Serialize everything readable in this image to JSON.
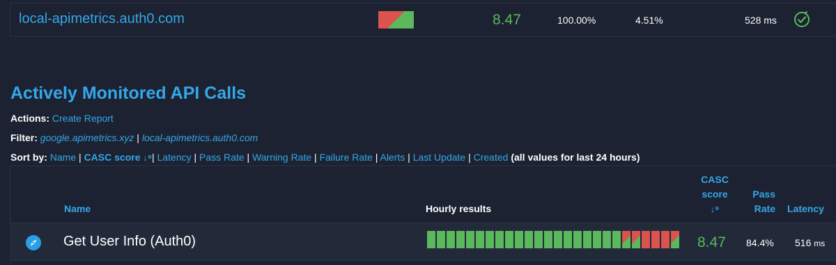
{
  "top_row": {
    "domain": "local-apimetrics.auth0.com",
    "casc_score": "8.47",
    "pass_rate": "100.00%",
    "warning_rate": "4.51%",
    "latency": "528 ms",
    "status_icon": "check-circle-icon"
  },
  "section": {
    "title": "Actively Monitored API Calls",
    "actions_label": "Actions:",
    "actions": [
      "Create Report"
    ],
    "filter_label": "Filter:",
    "filters": [
      "google.apimetrics.xyz",
      "local-apimetrics.auth0.com"
    ],
    "sort_label": "Sort by:",
    "sort_options": [
      "Name",
      "CASC score",
      "Latency",
      "Pass Rate",
      "Warning Rate",
      "Failure Rate",
      "Alerts",
      "Last Update",
      "Created"
    ],
    "sort_note": "(all values for last 24 hours)"
  },
  "table": {
    "headers": {
      "name": "Name",
      "hourly": "Hourly results",
      "casc_line1": "CASC",
      "casc_line2": "score",
      "pass_line1": "Pass",
      "pass_line2": "Rate",
      "latency": "Latency"
    },
    "rows": [
      {
        "name": "Get User Info (Auth0)",
        "icon": "compass-icon",
        "hourly": [
          "pass",
          "pass",
          "pass",
          "pass",
          "pass",
          "pass",
          "pass",
          "pass",
          "pass",
          "pass",
          "pass",
          "pass",
          "pass",
          "pass",
          "pass",
          "pass",
          "pass",
          "pass",
          "pass",
          "pass",
          "mixed",
          "mixed",
          "fail",
          "fail",
          "fail",
          "mixed"
        ],
        "casc_score": "8.47",
        "pass_rate": "84.4%",
        "latency_value": "516",
        "latency_unit": "ms"
      }
    ]
  },
  "colors": {
    "background": "#1c2231",
    "accent": "#35a7e8",
    "pass": "#5cb85c",
    "fail": "#d9534f"
  }
}
